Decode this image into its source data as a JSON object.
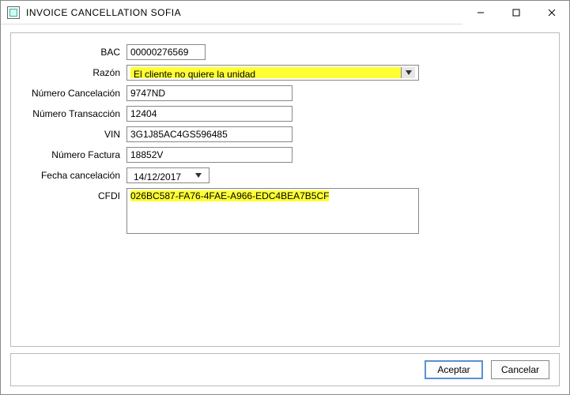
{
  "window": {
    "title": "INVOICE CANCELLATION SOFIA"
  },
  "labels": {
    "bac": "BAC",
    "razon": "Razón",
    "numCancelacion": "Número Cancelación",
    "numTransaccion": "Número Transacción",
    "vin": "VIN",
    "numFactura": "Número Factura",
    "fechaCancelacion": "Fecha cancelación",
    "cfdi": "CFDI"
  },
  "values": {
    "bac": "00000276569",
    "razon": "El cliente no quiere la unidad",
    "numCancelacion": "9747ND",
    "numTransaccion": "12404",
    "vin": "3G1J85AC4GS596485",
    "numFactura": "18852V",
    "fechaCancelacion": "14/12/2017",
    "cfdi": "026BC587-FA76-4FAE-A966-EDC4BEA7B5CF"
  },
  "buttons": {
    "accept": "Aceptar",
    "cancel": "Cancelar"
  },
  "fieldWidths": {
    "bac": "100px",
    "numCancelacion": "210px",
    "numTransaccion": "210px",
    "vin": "210px",
    "numFactura": "210px"
  }
}
